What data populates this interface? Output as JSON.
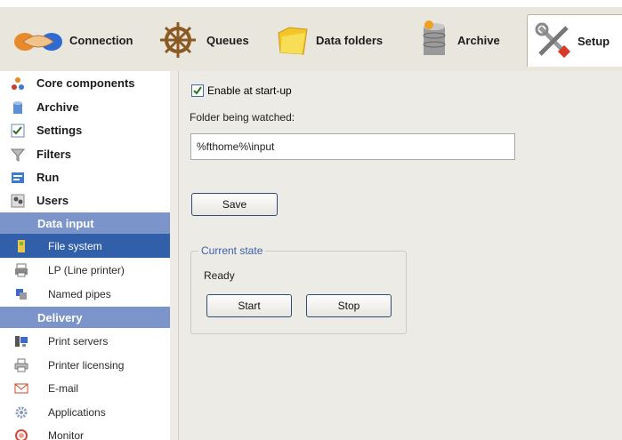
{
  "toolbar": {
    "items": [
      {
        "label": "Connection",
        "icon": "handshake-icon"
      },
      {
        "label": "Queues",
        "icon": "ship-wheel-icon"
      },
      {
        "label": "Data folders",
        "icon": "folder-icon"
      },
      {
        "label": "Archive",
        "icon": "database-icon"
      },
      {
        "label": "Setup",
        "icon": "tools-icon"
      }
    ],
    "active": "Setup"
  },
  "sidebar": {
    "top_items": [
      {
        "label": "Core components",
        "icon": "components-icon"
      },
      {
        "label": "Archive",
        "icon": "database-icon"
      },
      {
        "label": "Settings",
        "icon": "checklist-icon"
      },
      {
        "label": "Filters",
        "icon": "funnel-icon"
      },
      {
        "label": "Run",
        "icon": "run-icon"
      },
      {
        "label": "Users",
        "icon": "users-icon"
      }
    ],
    "data_input_header": "Data input",
    "data_input_items": [
      {
        "label": "File system",
        "icon": "file-system-icon",
        "selected": true
      },
      {
        "label": "LP (Line printer)",
        "icon": "line-printer-icon"
      },
      {
        "label": "Named pipes",
        "icon": "named-pipes-icon"
      }
    ],
    "delivery_header": "Delivery",
    "delivery_items": [
      {
        "label": "Print servers",
        "icon": "print-server-icon"
      },
      {
        "label": "Printer licensing",
        "icon": "printer-icon"
      },
      {
        "label": "E-mail",
        "icon": "envelope-icon"
      },
      {
        "label": "Applications",
        "icon": "gear-icon"
      },
      {
        "label": "Monitor",
        "icon": "monitor-icon"
      }
    ]
  },
  "main": {
    "enable_label": "Enable at start-up",
    "enable_checked": true,
    "folder_label": "Folder being watched:",
    "folder_value": "%fthome%\\input",
    "save_label": "Save",
    "current_state_title": "Current state",
    "state_text": "Ready",
    "start_label": "Start",
    "stop_label": "Stop"
  },
  "colors": {
    "selected": "#315fa9",
    "section_header": "#7b94c9",
    "panel_bg": "#ecebe6",
    "group_title": "#3d5fa6"
  }
}
